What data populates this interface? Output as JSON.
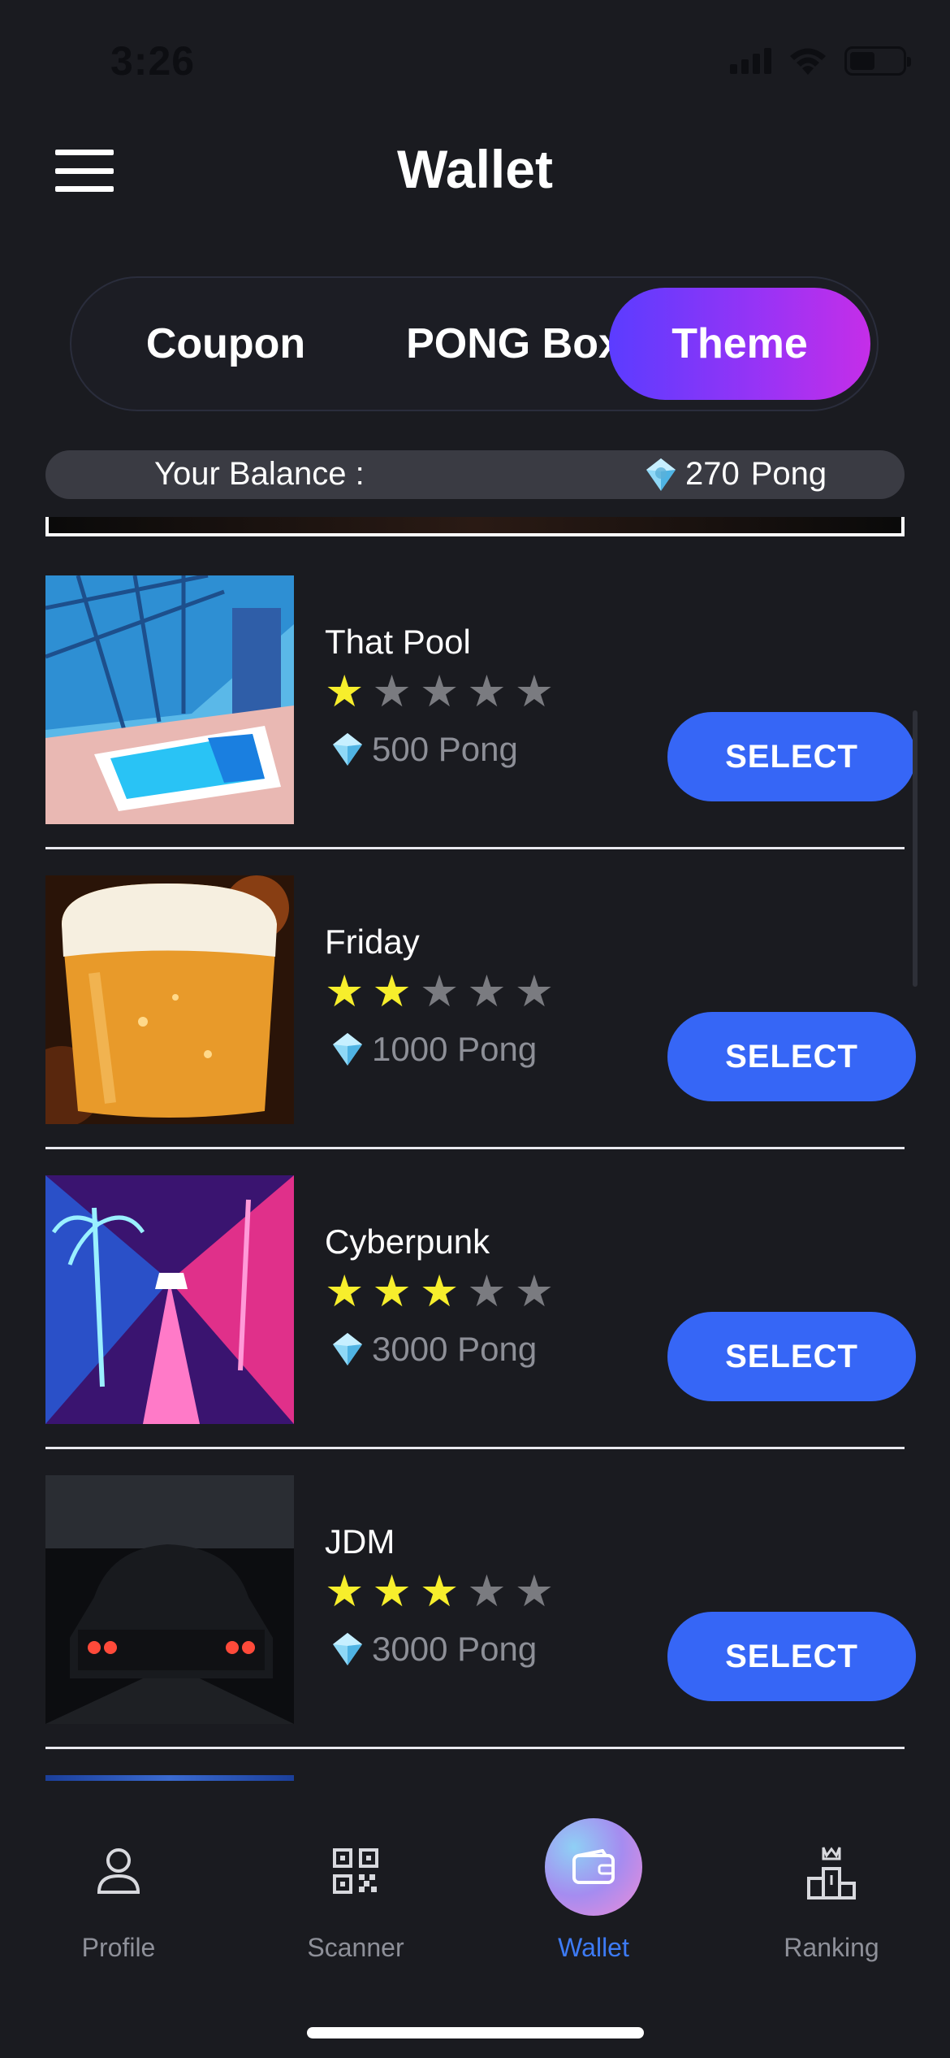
{
  "status_bar": {
    "time": "3:26"
  },
  "header": {
    "title": "Wallet"
  },
  "tabs": [
    {
      "label": "Coupon",
      "active": false
    },
    {
      "label": "PONG Box",
      "active": false
    },
    {
      "label": "Theme",
      "active": true
    }
  ],
  "balance": {
    "label": "Your Balance :",
    "value": "270",
    "unit": "Pong"
  },
  "themes": [
    {
      "name": "That Pool",
      "rating": 1,
      "price": "500 Pong",
      "button": "SELECT"
    },
    {
      "name": "Friday",
      "rating": 2,
      "price": "1000 Pong",
      "button": "SELECT"
    },
    {
      "name": "Cyberpunk",
      "rating": 3,
      "price": "3000 Pong",
      "button": "SELECT"
    },
    {
      "name": "JDM",
      "rating": 3,
      "price": "3000 Pong",
      "button": "SELECT"
    }
  ],
  "nav": [
    {
      "label": "Profile",
      "icon": "profile-icon",
      "active": false
    },
    {
      "label": "Scanner",
      "icon": "qr-code-icon",
      "active": false
    },
    {
      "label": "Wallet",
      "icon": "wallet-icon",
      "active": true
    },
    {
      "label": "Ranking",
      "icon": "podium-icon",
      "active": false
    }
  ],
  "colors": {
    "background": "#1a1b20",
    "accent_button": "#3666f6",
    "tab_gradient_start": "#5b3cff",
    "tab_gradient_end": "#c52ee8",
    "star_on": "#f7ee2c",
    "star_off": "#7a7b80",
    "active_nav": "#3d7bf6"
  }
}
